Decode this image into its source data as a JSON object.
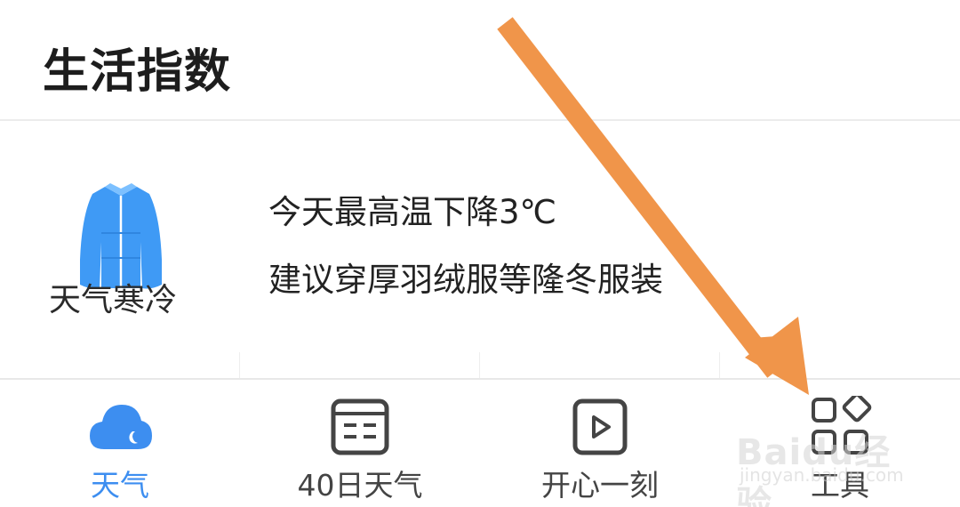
{
  "page_title": "生活指数",
  "index_card": {
    "icon": "down-jacket-icon",
    "label": "天气寒冷",
    "line1": "今天最高温下降3℃",
    "line2": "建议穿厚羽绒服等隆冬服装"
  },
  "tabs": [
    {
      "label": "天气",
      "icon": "weather-cloud-icon",
      "active": true
    },
    {
      "label": "40日天气",
      "icon": "calendar-icon",
      "active": false
    },
    {
      "label": "开心一刻",
      "icon": "video-play-icon",
      "active": false
    },
    {
      "label": "工具",
      "icon": "tools-grid-icon",
      "active": false
    }
  ],
  "watermark": {
    "logo": "Baidu经验",
    "sub": "jingyan.baidu.com"
  },
  "colors": {
    "accent": "#3d8ef0",
    "arrow": "#f0954a",
    "jacket": "#3f9af5"
  }
}
